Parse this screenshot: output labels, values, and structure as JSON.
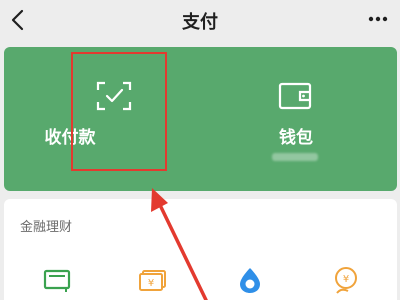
{
  "nav": {
    "title": "支付"
  },
  "tiles": {
    "pay": {
      "label": "收付款"
    },
    "wallet": {
      "label": "钱包"
    }
  },
  "finance": {
    "section_title": "金融理财"
  },
  "icons": {
    "back": "chevron-left-icon",
    "more": "more-dots-icon",
    "pay": "scan-check-icon",
    "wallet": "wallet-icon",
    "finance": [
      "card-icon",
      "yuan-note-icon",
      "water-drop-icon",
      "hand-coin-icon"
    ]
  },
  "colors": {
    "accent_green": "#58a96d",
    "highlight_red": "#e33a2f",
    "finance_green": "#3aa24f",
    "finance_orange": "#f0a33b",
    "finance_blue": "#2f8fe8"
  }
}
